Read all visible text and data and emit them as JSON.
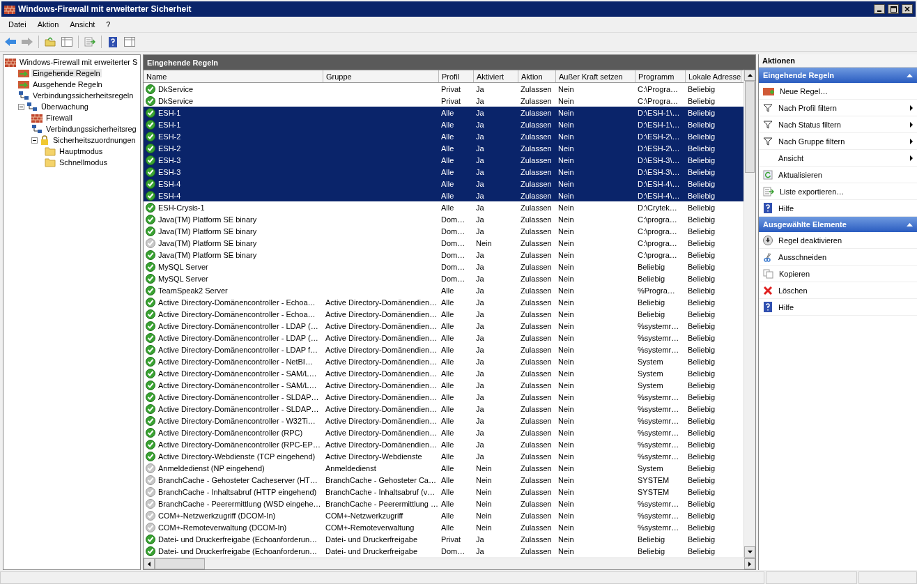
{
  "window": {
    "title": "Windows-Firewall mit erweiterter Sicherheit"
  },
  "menu": [
    "Datei",
    "Aktion",
    "Ansicht",
    "?"
  ],
  "tree": [
    {
      "label": "Windows-Firewall mit erweiterter S",
      "kind": "firewall",
      "selected": false,
      "children": [
        {
          "label": "Eingehende Regeln",
          "kind": "rules",
          "selected": true
        },
        {
          "label": "Ausgehende Regeln",
          "kind": "rules",
          "selected": false
        },
        {
          "label": "Verbindungssicherheitsregeln",
          "kind": "network",
          "selected": false
        },
        {
          "label": "Überwachung",
          "kind": "network",
          "selected": false,
          "expanded": true,
          "children": [
            {
              "label": "Firewall",
              "kind": "firewall",
              "selected": false
            },
            {
              "label": "Verbindungssicherheitsreg",
              "kind": "network",
              "selected": false
            },
            {
              "label": "Sicherheitszuordnungen",
              "kind": "lock",
              "selected": false,
              "expanded": true,
              "children": [
                {
                  "label": "Hauptmodus",
                  "kind": "folder",
                  "selected": false
                },
                {
                  "label": "Schnellmodus",
                  "kind": "folder",
                  "selected": false
                }
              ]
            }
          ]
        }
      ]
    }
  ],
  "panel": {
    "title": "Eingehende Regeln"
  },
  "table": {
    "columns": [
      "Name",
      "Gruppe",
      "Profil",
      "Aktiviert",
      "Aktion",
      "Außer Kraft setzen",
      "Programm",
      "Lokale Adresse"
    ],
    "rows": [
      {
        "cells": [
          "DkService",
          "",
          "Privat",
          "Ja",
          "Zulassen",
          "Nein",
          "C:\\Progra…",
          "Beliebig"
        ],
        "enabled": true,
        "selected": false
      },
      {
        "cells": [
          "DkService",
          "",
          "Privat",
          "Ja",
          "Zulassen",
          "Nein",
          "C:\\Progra…",
          "Beliebig"
        ],
        "enabled": true,
        "selected": false
      },
      {
        "cells": [
          "ESH-1",
          "",
          "Alle",
          "Ja",
          "Zulassen",
          "Nein",
          "D:\\ESH-1\\…",
          "Beliebig"
        ],
        "enabled": true,
        "selected": true
      },
      {
        "cells": [
          "ESH-1",
          "",
          "Alle",
          "Ja",
          "Zulassen",
          "Nein",
          "D:\\ESH-1\\…",
          "Beliebig"
        ],
        "enabled": true,
        "selected": true
      },
      {
        "cells": [
          "ESH-2",
          "",
          "Alle",
          "Ja",
          "Zulassen",
          "Nein",
          "D:\\ESH-2\\…",
          "Beliebig"
        ],
        "enabled": true,
        "selected": true
      },
      {
        "cells": [
          "ESH-2",
          "",
          "Alle",
          "Ja",
          "Zulassen",
          "Nein",
          "D:\\ESH-2\\…",
          "Beliebig"
        ],
        "enabled": true,
        "selected": true
      },
      {
        "cells": [
          "ESH-3",
          "",
          "Alle",
          "Ja",
          "Zulassen",
          "Nein",
          "D:\\ESH-3\\…",
          "Beliebig"
        ],
        "enabled": true,
        "selected": true
      },
      {
        "cells": [
          "ESH-3",
          "",
          "Alle",
          "Ja",
          "Zulassen",
          "Nein",
          "D:\\ESH-3\\…",
          "Beliebig"
        ],
        "enabled": true,
        "selected": true
      },
      {
        "cells": [
          "ESH-4",
          "",
          "Alle",
          "Ja",
          "Zulassen",
          "Nein",
          "D:\\ESH-4\\…",
          "Beliebig"
        ],
        "enabled": true,
        "selected": true
      },
      {
        "cells": [
          "ESH-4",
          "",
          "Alle",
          "Ja",
          "Zulassen",
          "Nein",
          "D:\\ESH-4\\…",
          "Beliebig"
        ],
        "enabled": true,
        "selected": true
      },
      {
        "cells": [
          "ESH-Crysis-1",
          "",
          "Alle",
          "Ja",
          "Zulassen",
          "Nein",
          "D:\\Crytek…",
          "Beliebig"
        ],
        "enabled": true,
        "selected": false
      },
      {
        "cells": [
          "Java(TM) Platform SE binary",
          "",
          "Dom…",
          "Ja",
          "Zulassen",
          "Nein",
          "C:\\progra…",
          "Beliebig"
        ],
        "enabled": true,
        "selected": false
      },
      {
        "cells": [
          "Java(TM) Platform SE binary",
          "",
          "Dom…",
          "Ja",
          "Zulassen",
          "Nein",
          "C:\\progra…",
          "Beliebig"
        ],
        "enabled": true,
        "selected": false
      },
      {
        "cells": [
          "Java(TM) Platform SE binary",
          "",
          "Dom…",
          "Nein",
          "Zulassen",
          "Nein",
          "C:\\progra…",
          "Beliebig"
        ],
        "enabled": false,
        "selected": false
      },
      {
        "cells": [
          "Java(TM) Platform SE binary",
          "",
          "Dom…",
          "Ja",
          "Zulassen",
          "Nein",
          "C:\\progra…",
          "Beliebig"
        ],
        "enabled": true,
        "selected": false
      },
      {
        "cells": [
          "MySQL Server",
          "",
          "Dom…",
          "Ja",
          "Zulassen",
          "Nein",
          "Beliebig",
          "Beliebig"
        ],
        "enabled": true,
        "selected": false
      },
      {
        "cells": [
          "MySQL Server",
          "",
          "Dom…",
          "Ja",
          "Zulassen",
          "Nein",
          "Beliebig",
          "Beliebig"
        ],
        "enabled": true,
        "selected": false
      },
      {
        "cells": [
          "TeamSpeak2 Server",
          "",
          "Alle",
          "Ja",
          "Zulassen",
          "Nein",
          "%Progra…",
          "Beliebig"
        ],
        "enabled": true,
        "selected": false
      },
      {
        "cells": [
          "Active Directory-Domänencontroller - Echoa…",
          "Active Directory-Domänendien…",
          "Alle",
          "Ja",
          "Zulassen",
          "Nein",
          "Beliebig",
          "Beliebig"
        ],
        "enabled": true,
        "selected": false
      },
      {
        "cells": [
          "Active Directory-Domänencontroller - Echoa…",
          "Active Directory-Domänendien…",
          "Alle",
          "Ja",
          "Zulassen",
          "Nein",
          "Beliebig",
          "Beliebig"
        ],
        "enabled": true,
        "selected": false
      },
      {
        "cells": [
          "Active Directory-Domänencontroller - LDAP (…",
          "Active Directory-Domänendien…",
          "Alle",
          "Ja",
          "Zulassen",
          "Nein",
          "%systemr…",
          "Beliebig"
        ],
        "enabled": true,
        "selected": false
      },
      {
        "cells": [
          "Active Directory-Domänencontroller - LDAP (…",
          "Active Directory-Domänendien…",
          "Alle",
          "Ja",
          "Zulassen",
          "Nein",
          "%systemr…",
          "Beliebig"
        ],
        "enabled": true,
        "selected": false
      },
      {
        "cells": [
          "Active Directory-Domänencontroller - LDAP f…",
          "Active Directory-Domänendien…",
          "Alle",
          "Ja",
          "Zulassen",
          "Nein",
          "%systemr…",
          "Beliebig"
        ],
        "enabled": true,
        "selected": false
      },
      {
        "cells": [
          "Active Directory-Domänencontroller - NetBI…",
          "Active Directory-Domänendien…",
          "Alle",
          "Ja",
          "Zulassen",
          "Nein",
          "System",
          "Beliebig"
        ],
        "enabled": true,
        "selected": false
      },
      {
        "cells": [
          "Active Directory-Domänencontroller - SAM/L…",
          "Active Directory-Domänendien…",
          "Alle",
          "Ja",
          "Zulassen",
          "Nein",
          "System",
          "Beliebig"
        ],
        "enabled": true,
        "selected": false
      },
      {
        "cells": [
          "Active Directory-Domänencontroller - SAM/L…",
          "Active Directory-Domänendien…",
          "Alle",
          "Ja",
          "Zulassen",
          "Nein",
          "System",
          "Beliebig"
        ],
        "enabled": true,
        "selected": false
      },
      {
        "cells": [
          "Active Directory-Domänencontroller - SLDAP…",
          "Active Directory-Domänendien…",
          "Alle",
          "Ja",
          "Zulassen",
          "Nein",
          "%systemr…",
          "Beliebig"
        ],
        "enabled": true,
        "selected": false
      },
      {
        "cells": [
          "Active Directory-Domänencontroller - SLDAP…",
          "Active Directory-Domänendien…",
          "Alle",
          "Ja",
          "Zulassen",
          "Nein",
          "%systemr…",
          "Beliebig"
        ],
        "enabled": true,
        "selected": false
      },
      {
        "cells": [
          "Active Directory-Domänencontroller - W32Ti…",
          "Active Directory-Domänendien…",
          "Alle",
          "Ja",
          "Zulassen",
          "Nein",
          "%systemr…",
          "Beliebig"
        ],
        "enabled": true,
        "selected": false
      },
      {
        "cells": [
          "Active Directory-Domänencontroller (RPC)",
          "Active Directory-Domänendien…",
          "Alle",
          "Ja",
          "Zulassen",
          "Nein",
          "%systemr…",
          "Beliebig"
        ],
        "enabled": true,
        "selected": false
      },
      {
        "cells": [
          "Active Directory-Domänencontroller (RPC-EP…",
          "Active Directory-Domänendien…",
          "Alle",
          "Ja",
          "Zulassen",
          "Nein",
          "%systemr…",
          "Beliebig"
        ],
        "enabled": true,
        "selected": false
      },
      {
        "cells": [
          "Active Directory-Webdienste (TCP eingehend)",
          "Active Directory-Webdienste",
          "Alle",
          "Ja",
          "Zulassen",
          "Nein",
          "%systemr…",
          "Beliebig"
        ],
        "enabled": true,
        "selected": false
      },
      {
        "cells": [
          "Anmeldedienst (NP eingehend)",
          "Anmeldedienst",
          "Alle",
          "Nein",
          "Zulassen",
          "Nein",
          "System",
          "Beliebig"
        ],
        "enabled": false,
        "selected": false
      },
      {
        "cells": [
          "BranchCache - Gehosteter Cacheserver (HT…",
          "BranchCache - Gehosteter Ca…",
          "Alle",
          "Nein",
          "Zulassen",
          "Nein",
          "SYSTEM",
          "Beliebig"
        ],
        "enabled": false,
        "selected": false
      },
      {
        "cells": [
          "BranchCache - Inhaltsabruf (HTTP eingehend)",
          "BranchCache - Inhaltsabruf (v…",
          "Alle",
          "Nein",
          "Zulassen",
          "Nein",
          "SYSTEM",
          "Beliebig"
        ],
        "enabled": false,
        "selected": false
      },
      {
        "cells": [
          "BranchCache - Peerermittlung (WSD eingehe…",
          "BranchCache - Peerermittlung …",
          "Alle",
          "Nein",
          "Zulassen",
          "Nein",
          "%systemr…",
          "Beliebig"
        ],
        "enabled": false,
        "selected": false
      },
      {
        "cells": [
          "COM+-Netzwerkzugriff (DCOM-In)",
          "COM+-Netzwerkzugriff",
          "Alle",
          "Nein",
          "Zulassen",
          "Nein",
          "%systemr…",
          "Beliebig"
        ],
        "enabled": false,
        "selected": false
      },
      {
        "cells": [
          "COM+-Remoteverwaltung (DCOM-In)",
          "COM+-Remoteverwaltung",
          "Alle",
          "Nein",
          "Zulassen",
          "Nein",
          "%systemr…",
          "Beliebig"
        ],
        "enabled": false,
        "selected": false
      },
      {
        "cells": [
          "Datei- und Druckerfreigabe (Echoanforderun…",
          "Datei- und Druckerfreigabe",
          "Privat",
          "Ja",
          "Zulassen",
          "Nein",
          "Beliebig",
          "Beliebig"
        ],
        "enabled": true,
        "selected": false
      },
      {
        "cells": [
          "Datei- und Druckerfreigabe (Echoanforderun…",
          "Datei- und Druckerfreigabe",
          "Dom…",
          "Ja",
          "Zulassen",
          "Nein",
          "Beliebig",
          "Beliebig"
        ],
        "enabled": true,
        "selected": false
      }
    ]
  },
  "actions": {
    "title": "Aktionen",
    "sections": [
      {
        "title": "Eingehende Regeln",
        "items": [
          {
            "label": "Neue Regel…",
            "kind": "new",
            "submenu": false
          },
          {
            "label": "Nach Profil filtern",
            "kind": "filter",
            "submenu": true
          },
          {
            "label": "Nach Status filtern",
            "kind": "filter",
            "submenu": true
          },
          {
            "label": "Nach Gruppe filtern",
            "kind": "filter",
            "submenu": true
          },
          {
            "label": "Ansicht",
            "kind": "none",
            "submenu": true
          },
          {
            "label": "Aktualisieren",
            "kind": "refresh",
            "submenu": false
          },
          {
            "label": "Liste exportieren…",
            "kind": "export",
            "submenu": false
          },
          {
            "label": "Hilfe",
            "kind": "help",
            "submenu": false
          }
        ]
      },
      {
        "title": "Ausgewählte Elemente",
        "items": [
          {
            "label": "Regel deaktivieren",
            "kind": "disable",
            "submenu": false
          },
          {
            "label": "Ausschneiden",
            "kind": "cut",
            "submenu": false
          },
          {
            "label": "Kopieren",
            "kind": "copy",
            "submenu": false
          },
          {
            "label": "Löschen",
            "kind": "delete",
            "submenu": false
          },
          {
            "label": "Hilfe",
            "kind": "help",
            "submenu": false
          }
        ]
      }
    ]
  }
}
